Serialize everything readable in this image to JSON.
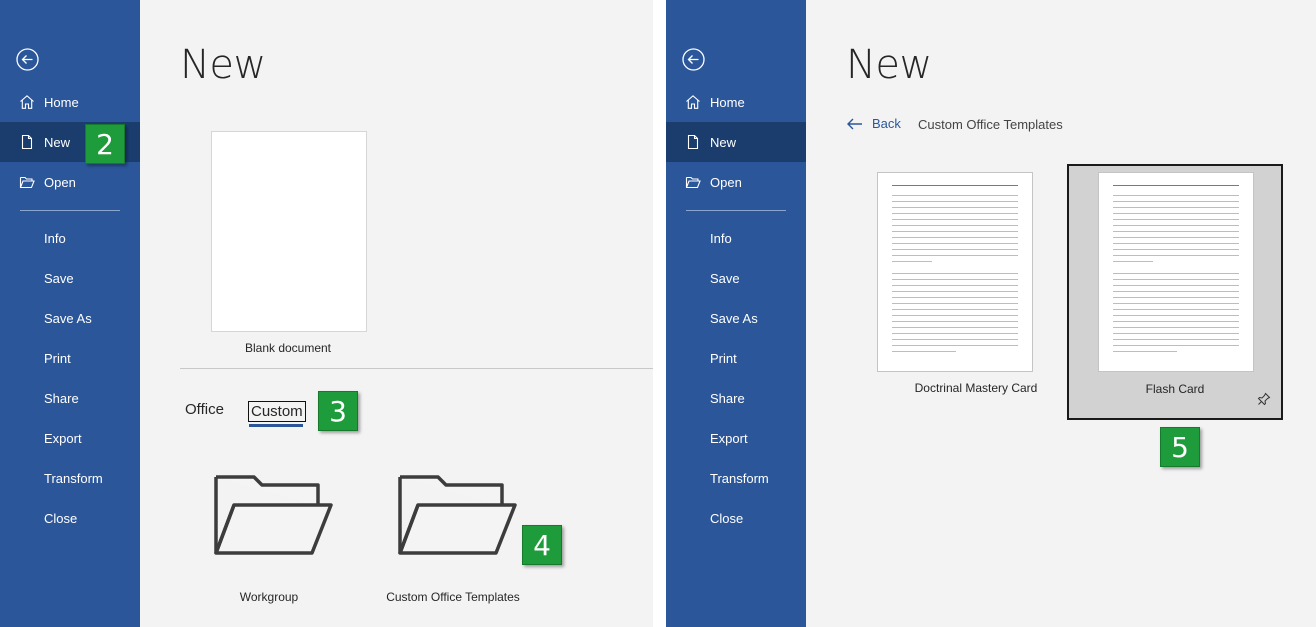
{
  "panels": [
    {
      "sidebar": {
        "items": [
          {
            "label": "Home",
            "icon": "home-icon"
          },
          {
            "label": "New",
            "icon": "new-document-icon"
          },
          {
            "label": "Open",
            "icon": "open-folder-icon"
          },
          {
            "label": "Info"
          },
          {
            "label": "Save"
          },
          {
            "label": "Save As"
          },
          {
            "label": "Print"
          },
          {
            "label": "Share"
          },
          {
            "label": "Export"
          },
          {
            "label": "Transform"
          },
          {
            "label": "Close"
          }
        ]
      },
      "title": "New",
      "blank_document_label": "Blank document",
      "tabs": {
        "office": "Office",
        "custom": "Custom"
      },
      "folders": [
        {
          "label": "Workgroup"
        },
        {
          "label": "Custom Office Templates"
        }
      ],
      "badges": [
        "2",
        "3",
        "4"
      ]
    },
    {
      "sidebar": {
        "items": [
          {
            "label": "Home",
            "icon": "home-icon"
          },
          {
            "label": "New",
            "icon": "new-document-icon"
          },
          {
            "label": "Open",
            "icon": "open-folder-icon"
          },
          {
            "label": "Info"
          },
          {
            "label": "Save"
          },
          {
            "label": "Save As"
          },
          {
            "label": "Print"
          },
          {
            "label": "Share"
          },
          {
            "label": "Export"
          },
          {
            "label": "Transform"
          },
          {
            "label": "Close"
          }
        ]
      },
      "title": "New",
      "back_label": "Back",
      "breadcrumb": "Custom Office Templates",
      "templates": [
        {
          "label": "Doctrinal Mastery Card"
        },
        {
          "label": "Flash Card"
        }
      ],
      "badges": [
        "5"
      ]
    }
  ],
  "colors": {
    "sidebar": "#2b579a",
    "sidebar_active": "#1a3d6e",
    "badge": "#1e9b3a",
    "content_bg": "#f3f3f3"
  }
}
